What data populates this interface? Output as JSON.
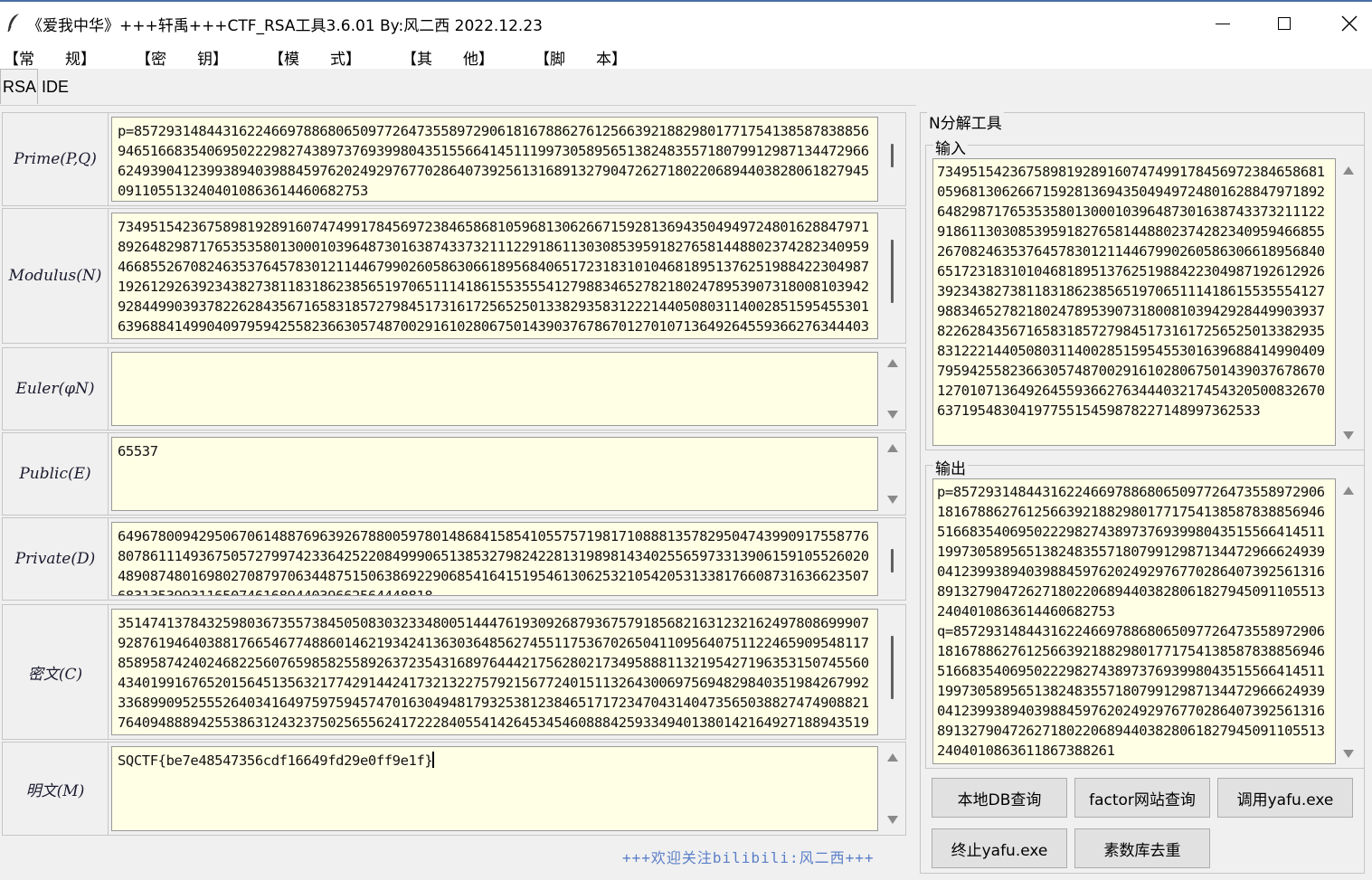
{
  "window": {
    "title": "《爱我中华》+++轩禹+++CTF_RSA工具3.6.01   By:风二西 2022.12.23",
    "minimize_glyph": "—",
    "maximize_glyph": "☐",
    "close_glyph": "✕"
  },
  "menu": [
    "【常　　规】",
    "【密　　钥】",
    "【模　　式】",
    "【其　　他】",
    "【脚　　本】"
  ],
  "tabs": [
    "RSA",
    "IDE"
  ],
  "rows": {
    "prime": {
      "label": "Prime(P,Q)",
      "value": "p=857293148443162246697886806509772647355897290618167886276125663921882980177175413858783885694651668354069502229827438973769399804351556641451119973058956513824835571807991298713447296662493904123993894039884597620249297677028640739256131689132790472627180220689440382806182794509110551324040108636144606827​53\nq=857293148443162246697886806509772647355897290618167886276125663921882980177175"
    },
    "modulus": {
      "label": "Modulus(N)",
      "value": "734951542367589819289160747499178456972384658681059681306266715928136943504949724801628847971892648298717653535801300010396487301638743373211122918611303085395918276581448802374282340959466855267082463537645783012114467990260586306618956840651723183101046818951376251988422304987192612926392343827381183186238565197065111418615535554127988346527821802478953907318008103942928449903937822628435671658318572798451731617256525013382935831222144050803114002851595455301639688414990409795942558236630574870029161028067501439037678670127010713649264559366276344403"
    },
    "euler": {
      "label": "Euler(φN)",
      "value": ""
    },
    "public": {
      "label": "Public(E)",
      "value": "65537"
    },
    "private": {
      "label": "Private(D)",
      "value": "649678009429506706148876963926788005978014868415854105575719817108881357829504743990917558776807861114936750572799742336425220849990651385327982422813198981434025565973313906159105526020489087480169802708797063448751506386922906854164151954613062532105420531338176608731636623507683135399311650746168944039662564448818"
    },
    "cipher": {
      "label": "密文(C)",
      "value": "351474137843259803673557384505083032334800514447619309268793675791856821631232162497808699907928761946403881766546774886014621934241363036485627455117536702650411095640751122465909548117858958742402468225607659858255892637235431689764442175628021734958881132195427196353150745560434019916765201564513563217742914424173213227579215677240151132643006975694829840351984267992336899095255526403416497597594574701630494817932538123846517172347043140473565038827474908821764094888942553863124323750256556241722284055414264534546088842593349401380142164927188943519"
    },
    "plain": {
      "label": "明文(M)",
      "value": "SQCTF{be7e48547356cdf16649fd29e0ff9e1f}"
    }
  },
  "right_panel": {
    "title": "N分解工具",
    "input_label": "输入",
    "input_value": "734951542367589819289160747499178456972384658681059681306266715928136943504949724801628847971892648298717653535801300010396487301638743373211122918611303085395918276581448802374282340959466855267082463537645783012114467990260586306618956840651723183101046818951376251988422304987192612926392343827381183186238565197065111418615535554127988346527821802478953907318008103942928449903937822628435671658318572798451731617256525013382935831222144050803114002851595455301639688414990409795942558236630574870029161028067501439037678670127010713649264559366276344403217454320500832670637195483041977551545987822714899736253​3",
    "output_label": "输出",
    "output_value": "p=857293148443162246697886806509772647355897290618167886276125663921882980177175413858783885694651668354069502229827438973769399804351556641451119973058956513824835571807991298713447296662493904123993894039884597620249297677028640739256131689132790472627180220689440382806182794509110551324040108636144606827​53\nq=857293148443162246697886806509772647355897290618167886276125663921882980177175413858783885694651668354069502229827438973769399804351556641451119973058956513824835571807991298713447296662493904123993894039884597620249297677028640739256131689132790472627180220689440382806182794509110551324040108636118673882​61",
    "buttons": [
      "本地DB查询",
      "factor网站查询",
      "调用yafu.exe",
      "终止yafu.exe",
      "素数库去重"
    ]
  },
  "footer": "+++欢迎关注bilibili:风二西+++",
  "colors": {
    "field_bg": "#ffffe6",
    "footer": "#5a7fc8",
    "label": "#1a1a2e"
  }
}
